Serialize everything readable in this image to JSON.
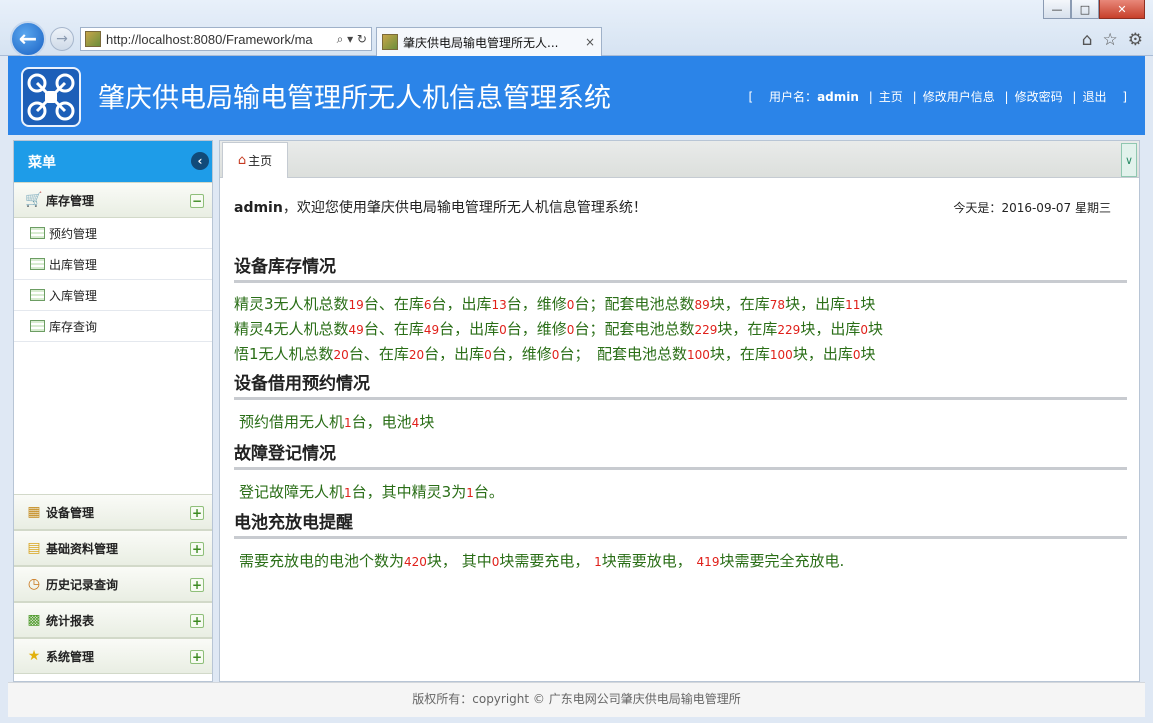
{
  "browser": {
    "url": "http://localhost:8080/Framework/ma",
    "addr_icons": "⌕ ▾ ↻",
    "tab_title": "肇庆供电局输电管理所无人...",
    "tab_close": "×",
    "win_min": "—",
    "win_max": "□",
    "win_close": "✕"
  },
  "header": {
    "title": "肇庆供电局输电管理所无人机信息管理系统",
    "bracket_open": "[",
    "username_label": "用户名：",
    "username": "admin",
    "links": [
      "主页",
      "修改用户信息",
      "修改密码",
      "退出"
    ],
    "bracket_close": "]"
  },
  "sidebar": {
    "title": "菜单",
    "groups": [
      {
        "label": "库存管理",
        "toggle": "−",
        "items": [
          "预约管理",
          "出库管理",
          "入库管理",
          "库存查询"
        ]
      },
      {
        "label": "设备管理",
        "toggle": "+"
      },
      {
        "label": "基础资料管理",
        "toggle": "+"
      },
      {
        "label": "历史记录查询",
        "toggle": "+"
      },
      {
        "label": "统计报表",
        "toggle": "+"
      },
      {
        "label": "系统管理",
        "toggle": "+"
      }
    ]
  },
  "main": {
    "home_tab": "主页",
    "welcome_user": "admin",
    "welcome_text": "，欢迎您使用肇庆供电局输电管理所无人机信息管理系统！",
    "today_label": "今天是：",
    "today_value": "2016-09-07 星期三",
    "sections": {
      "inventory": {
        "title": "设备库存情况",
        "rows": [
          {
            "model": "精灵3无人机总数",
            "total": "19",
            "in": "6",
            "out": "13",
            "repair": "0",
            "sep": "；",
            "bat_total": "89",
            "bat_in": "78",
            "bat_out": "11"
          },
          {
            "model": "精灵4无人机总数",
            "total": "49",
            "in": "49",
            "out": "0",
            "repair": "0",
            "sep": "；",
            "bat_total": "229",
            "bat_in": "229",
            "bat_out": "0"
          },
          {
            "model": "悟1无人机总数",
            "total": "20",
            "in": "20",
            "out": "0",
            "repair": "0",
            "sep": "；　",
            "bat_total": "100",
            "bat_in": "100",
            "bat_out": "0"
          }
        ]
      },
      "booking": {
        "title": "设备借用预约情况",
        "text_a": "预约借用无人机",
        "drones": "1",
        "text_b": "台，电池",
        "batteries": "4",
        "text_c": "块"
      },
      "fault": {
        "title": "故障登记情况",
        "text_a": "登记故障无人机",
        "count": "1",
        "text_b": "台，其中精灵3为",
        "p3": "1",
        "text_c": "台。"
      },
      "battery": {
        "title": "电池充放电提醒",
        "text_a": "需要充放电的电池个数为",
        "total": "420",
        "text_b": "块， 其中",
        "charge": "0",
        "text_c": "块需要充电， ",
        "discharge": "1",
        "text_d": "块需要放电， ",
        "full": "419",
        "text_e": "块需要完全充放电."
      }
    }
  },
  "footer": "版权所有：copyright © 广东电网公司肇庆供电局输电管理所",
  "colors": {
    "header_blue": "#2b84e8",
    "menu_blue": "#1e9ce8",
    "text_green": "#2a6e17",
    "number_red": "#e0201a"
  }
}
